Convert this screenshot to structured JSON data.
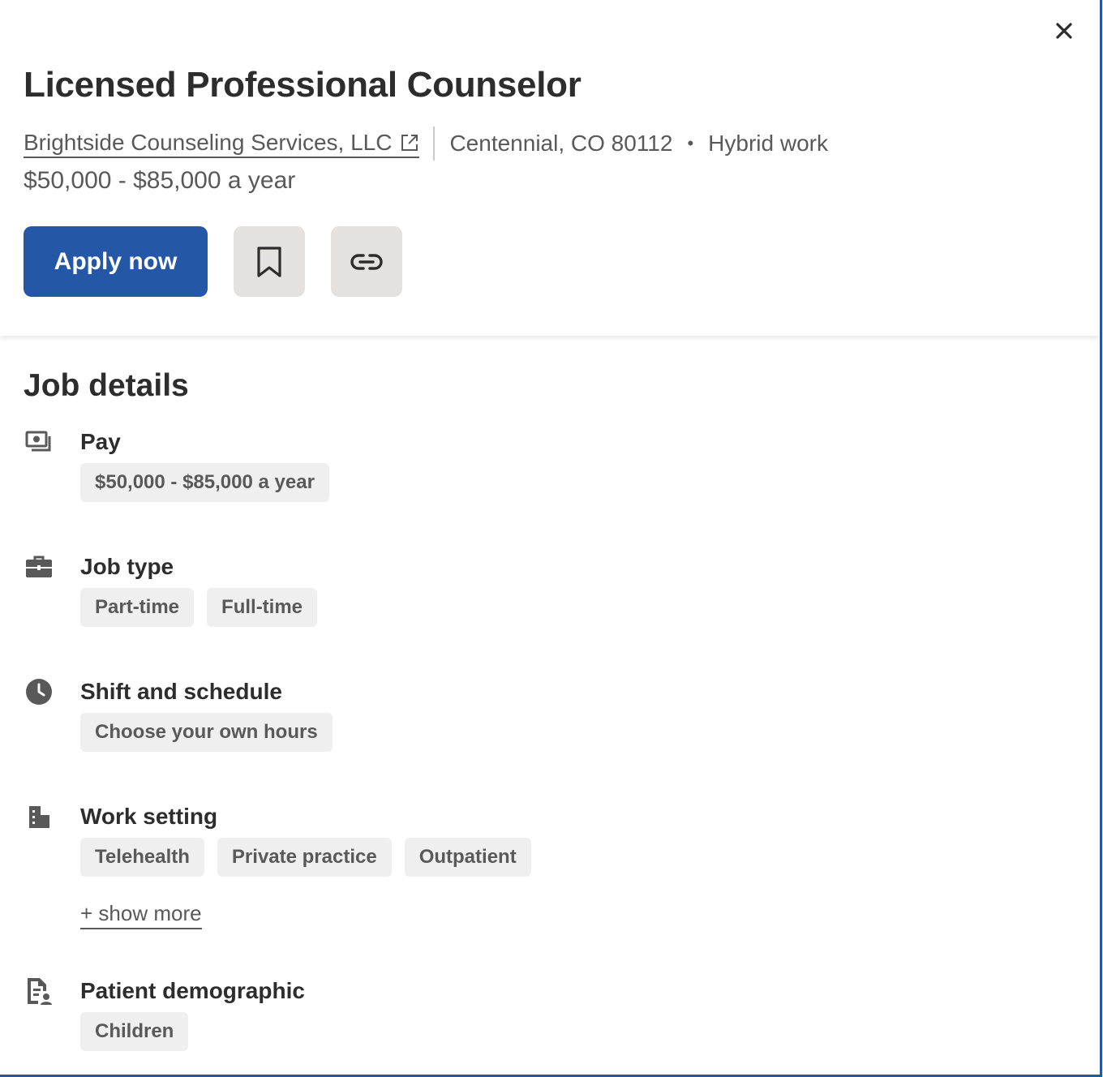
{
  "header": {
    "close_icon": "close-icon",
    "title": "Licensed Professional Counselor",
    "company": "Brightside Counseling Services, LLC",
    "location": "Centennial, CO 80112",
    "separator": "•",
    "work_mode": "Hybrid work",
    "salary": "$50,000 - $85,000 a year",
    "apply_label": "Apply now",
    "save_icon": "bookmark-icon",
    "copy_link_icon": "link-icon"
  },
  "details": {
    "title": "Job details",
    "sections": [
      {
        "label": "Pay",
        "icon": "money-icon",
        "chips": [
          "$50,000 - $85,000 a year"
        ]
      },
      {
        "label": "Job type",
        "icon": "briefcase-icon",
        "chips": [
          "Part-time",
          "Full-time"
        ]
      },
      {
        "label": "Shift and schedule",
        "icon": "clock-icon",
        "chips": [
          "Choose your own hours"
        ]
      },
      {
        "label": "Work setting",
        "icon": "building-icon",
        "chips": [
          "Telehealth",
          "Private practice",
          "Outpatient"
        ],
        "show_more": "+ show more"
      },
      {
        "label": "Patient demographic",
        "icon": "patient-document-icon",
        "chips": [
          "Children"
        ]
      }
    ]
  },
  "colors": {
    "brand_blue": "#2557a7",
    "text_primary": "#2d2d2d",
    "text_secondary": "#595959",
    "chip_bg": "#efefef",
    "icon_button_bg": "#e4e2e0"
  }
}
